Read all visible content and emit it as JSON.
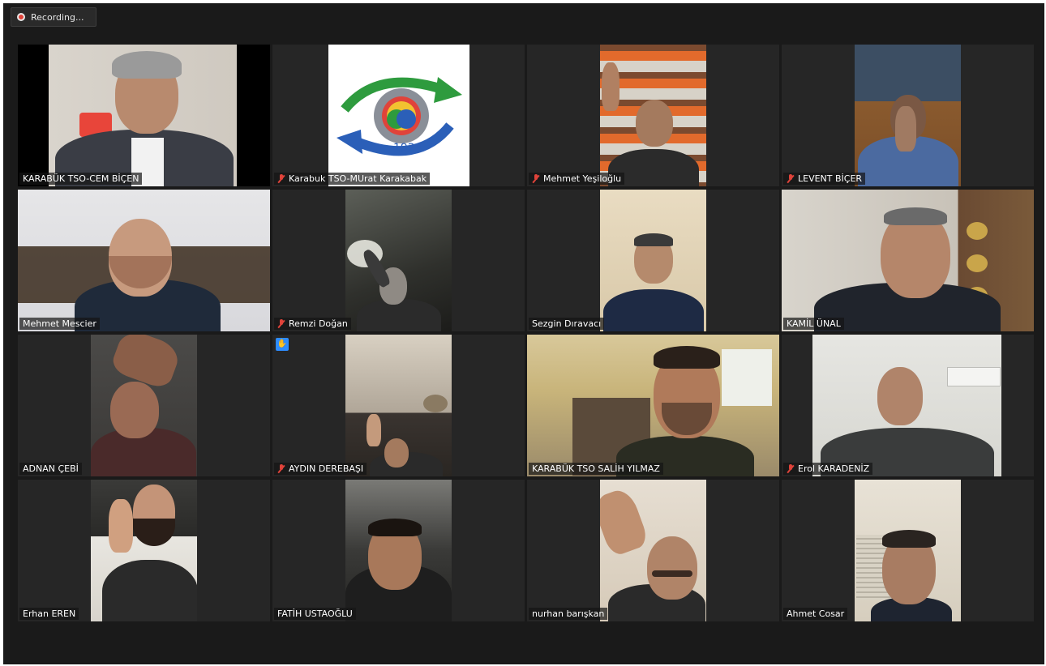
{
  "recording": {
    "label": "Recording..."
  },
  "participants": [
    {
      "name": "KARABÜK TSO-CEM BİÇEN",
      "muted": false
    },
    {
      "name": "Karabuk TSO-MUrat Karakabak",
      "muted": true
    },
    {
      "name": "Mehmet Yeşiloğlu",
      "muted": true
    },
    {
      "name": "LEVENT BİÇER",
      "muted": true
    },
    {
      "name": "Mehmet Mescier",
      "muted": false
    },
    {
      "name": "Remzi Doğan",
      "muted": true
    },
    {
      "name": "Sezgin Dıravacı",
      "muted": false
    },
    {
      "name": "KAMİL ÜNAL",
      "muted": false
    },
    {
      "name": "ADNAN ÇEBİ",
      "muted": false
    },
    {
      "name": "AYDIN DEREBAŞI",
      "muted": true,
      "hand_raised": true
    },
    {
      "name": "KARABÜK TSO SALİH YILMAZ",
      "muted": false,
      "active_speaker": true
    },
    {
      "name": "Erol KARADENİZ",
      "muted": true
    },
    {
      "name": "Erhan EREN",
      "muted": false
    },
    {
      "name": "FATİH USTAOĞLU",
      "muted": false
    },
    {
      "name": "nurhan barışkan",
      "muted": false
    },
    {
      "name": "Ahmet Cosar",
      "muted": false
    }
  ],
  "colors": {
    "active_border": "#c3d654",
    "muted_icon": "#e0433a",
    "raise_hand_badge": "#2d8cff",
    "tile_bg": "#262626",
    "window_bg": "#1a1a1a"
  },
  "icons": {
    "recording": "record-dot-icon",
    "muted": "mic-muted-icon",
    "hand": "raised-hand-icon"
  }
}
